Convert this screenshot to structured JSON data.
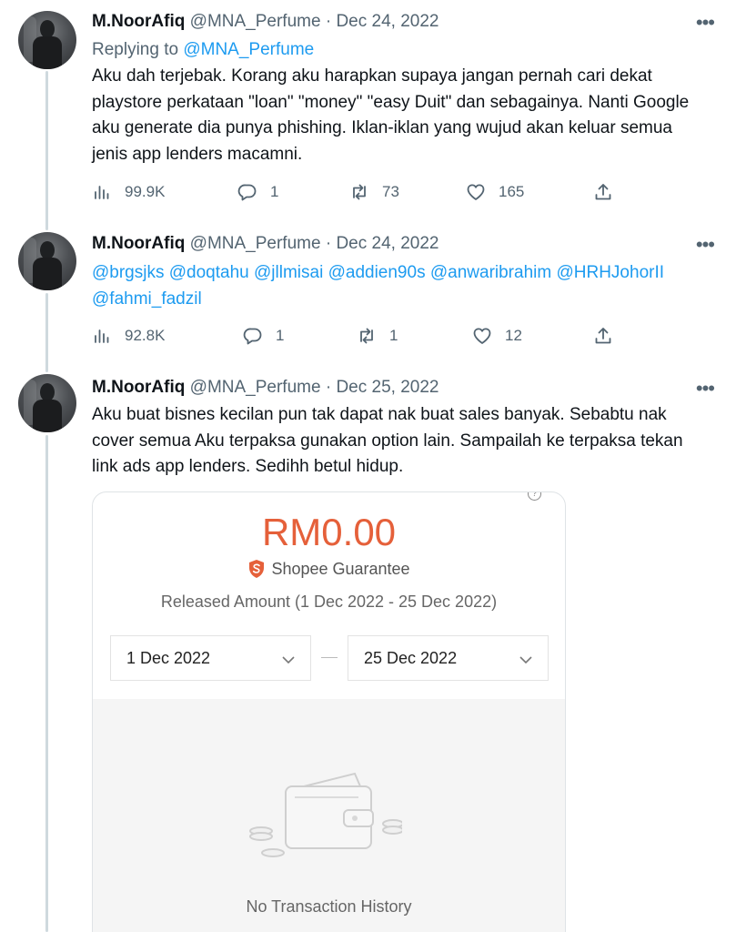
{
  "author": {
    "name": "M.NoorAfiq",
    "handle": "@MNA_Perfume"
  },
  "separator": "·",
  "tweets": [
    {
      "date": "Dec 24, 2022",
      "reply_prefix": "Replying to",
      "reply_handle": "@MNA_Perfume",
      "text": "Aku dah terjebak. Korang aku harapkan supaya jangan pernah cari dekat playstore perkataan \"loan\" \"money\" \"easy Duit\" dan sebagainya. Nanti Google aku generate dia punya phishing. Iklan-iklan yang wujud akan keluar semua jenis app lenders macamni.",
      "stats": {
        "views": "99.9K",
        "replies": "1",
        "retweets": "73",
        "likes": "165"
      }
    },
    {
      "date": "Dec 24, 2022",
      "mentions": [
        "@brgsjks",
        "@doqtahu",
        "@jllmisai",
        "@addien90s",
        "@anwaribrahim",
        "@HRHJohorII",
        "@fahmi_fadzil"
      ],
      "stats": {
        "views": "92.8K",
        "replies": "1",
        "retweets": "1",
        "likes": "12"
      }
    },
    {
      "date": "Dec 25, 2022",
      "text": "Aku buat bisnes kecilan pun tak dapat nak buat sales banyak. Sebabtu nak cover semua Aku terpaksa gunakan option lain. Sampailah ke terpaksa tekan link ads app lenders. Sedihh betul hidup."
    }
  ],
  "embedded_screenshot": {
    "amount": "RM0.00",
    "guarantee_label": "Shopee Guarantee",
    "released_label": "Released Amount (1 Dec 2022 - 25 Dec 2022)",
    "start_date": "1 Dec 2022",
    "end_date": "25 Dec 2022",
    "empty_label": "No Transaction History",
    "accent_color": "#e5603a"
  },
  "icons": {
    "more": "more-horizontal-icon",
    "views": "analytics-icon",
    "reply": "reply-icon",
    "retweet": "retweet-icon",
    "like": "heart-icon",
    "share": "share-icon"
  },
  "colors": {
    "link": "#1d9bf0",
    "muted": "#536471",
    "thread_line": "#cfd9de"
  }
}
